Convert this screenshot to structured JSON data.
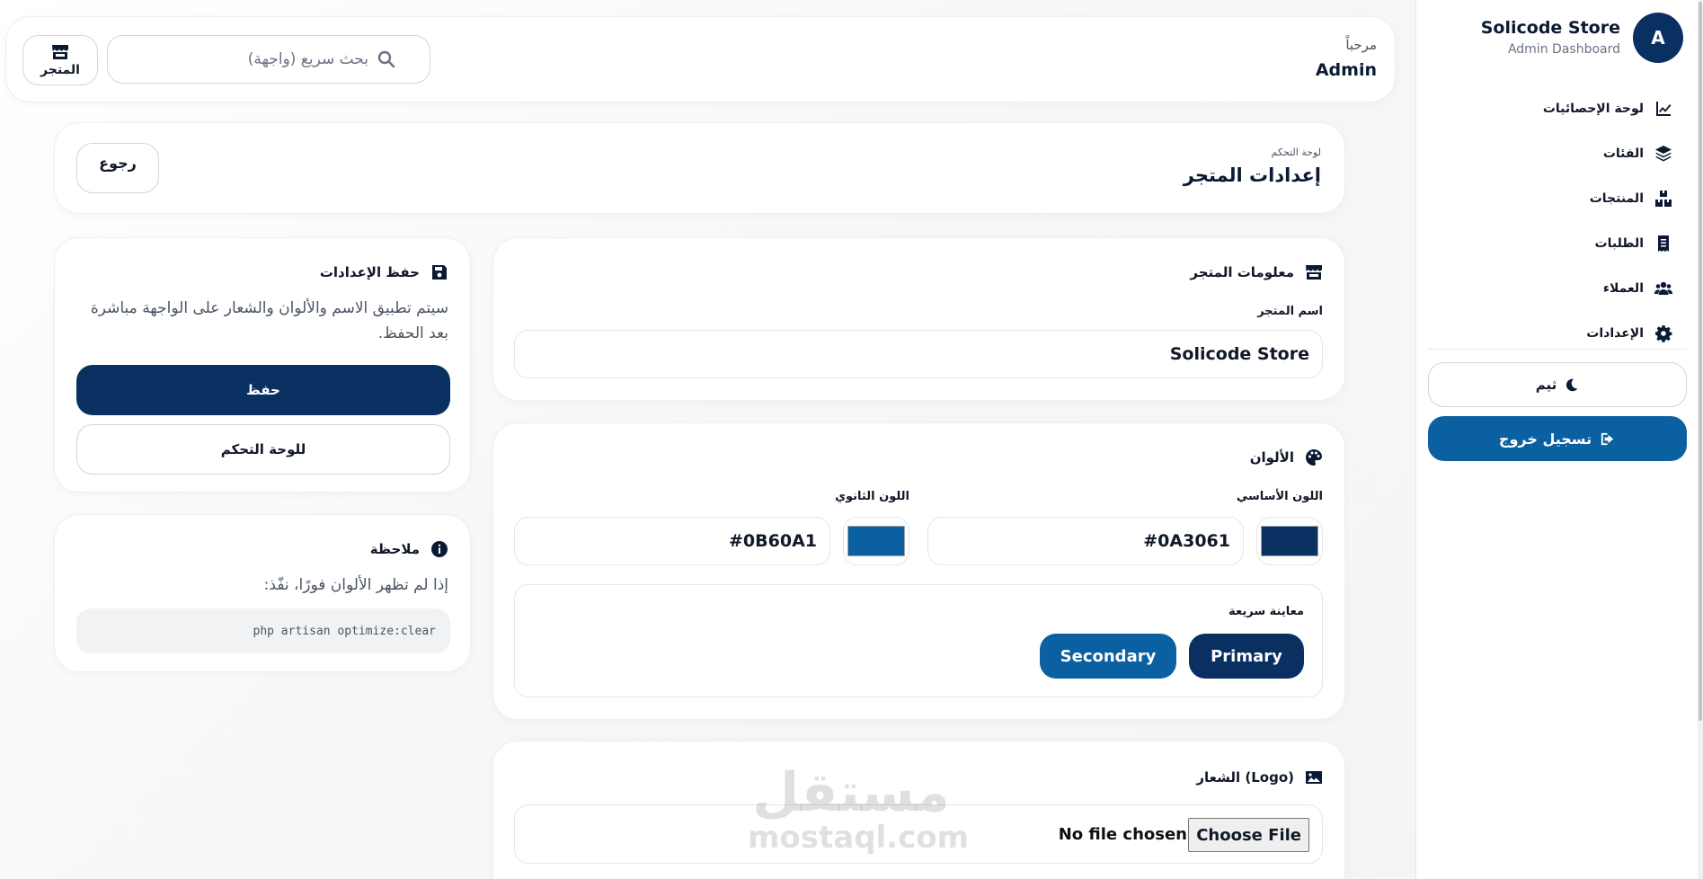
{
  "sidebar": {
    "avatar_letter": "A",
    "brand_name": "Solicode Store",
    "brand_sub": "Admin Dashboard",
    "items": [
      {
        "label": "لوحة الإحصائيات",
        "icon": "chart-line-icon"
      },
      {
        "label": "الفئات",
        "icon": "layers-icon"
      },
      {
        "label": "المنتجات",
        "icon": "boxes-icon"
      },
      {
        "label": "الطلبات",
        "icon": "receipt-icon"
      },
      {
        "label": "العملاء",
        "icon": "users-icon"
      },
      {
        "label": "الإعدادات",
        "icon": "gear-icon"
      }
    ],
    "theme_label": "ثيم",
    "logout_label": "تسجيل خروج"
  },
  "header": {
    "welcome": "مرحباً",
    "admin": "Admin",
    "search_placeholder": "بحث سريع (واجهة)",
    "store_label": "المتجر"
  },
  "page": {
    "breadcrumb": "لوحة التحكم",
    "title": "إعدادات المتجر",
    "back_label": "رجوع"
  },
  "store_info": {
    "title": "معلومات المتجر",
    "name_label": "اسم المتجر",
    "name_value": "Solicode Store"
  },
  "colors": {
    "title": "الألوان",
    "primary_label": "اللون الأساسي",
    "primary_value": "#0A3061",
    "secondary_label": "اللون الثانوي",
    "secondary_value": "#0B60A1",
    "preview_label": "معاينة سريعة",
    "primary_button": "Primary",
    "secondary_button": "Secondary"
  },
  "logo": {
    "title": "الشعار (Logo)",
    "choose_file": "Choose File",
    "no_file": "No file chosen"
  },
  "save_card": {
    "title": "حفظ الإعدادات",
    "description": "سيتم تطبيق الاسم والألوان والشعار على الواجهة مباشرة بعد الحفظ.",
    "save_button": "حفظ",
    "dashboard_button": "للوحة التحكم"
  },
  "note_card": {
    "title": "ملاحظة",
    "text": "إذا لم تظهر الألوان فورًا، نفّذ:",
    "command": "php artisan optimize:clear"
  },
  "watermark": {
    "arabic": "مستقل",
    "latin": "mostaql.com"
  }
}
